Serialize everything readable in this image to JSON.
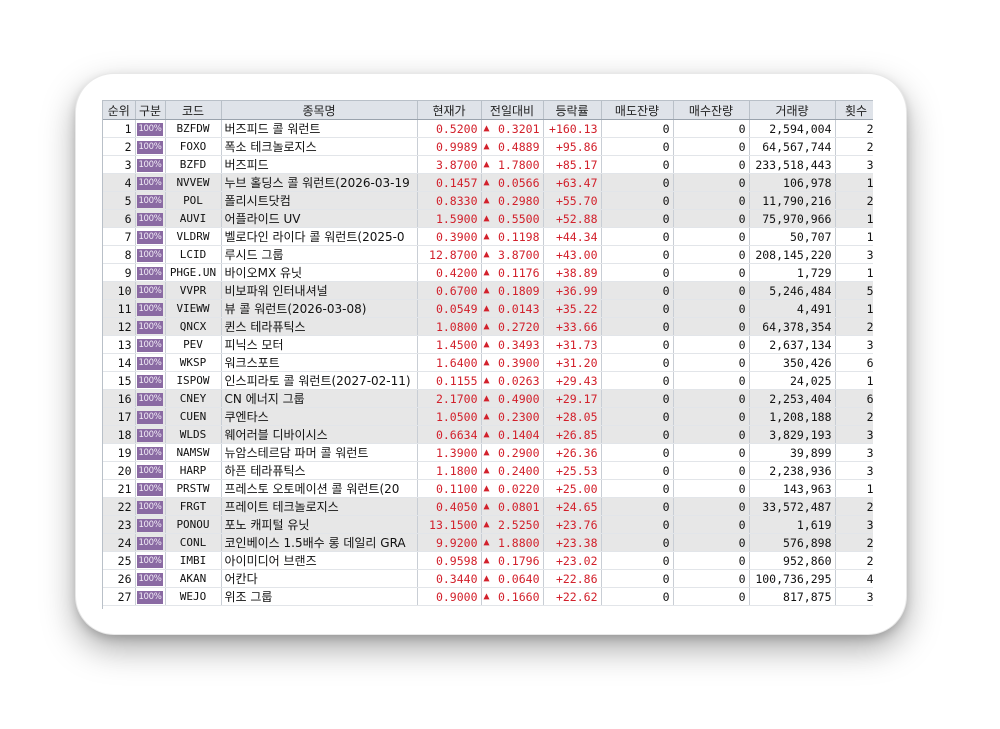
{
  "columns": [
    "순위",
    "구분",
    "코드",
    "종목명",
    "현재가",
    "전일대비",
    "등락률",
    "매도잔량",
    "매수잔량",
    "거래량",
    "횟수"
  ],
  "icons": {
    "kind_badge": "margin-100-badge",
    "change_marker": "up-triangle-icon"
  },
  "colors": {
    "up": "#d2202b",
    "badge": "#8a6aa3",
    "header_bg": "#dfe3e9",
    "shade_bg": "#e7e7e7"
  },
  "rows": [
    {
      "rank": "1",
      "kind": "100%",
      "code": "BZFDW",
      "name": "버즈피드 콜 워런트",
      "price": "0.5200",
      "diff": "0.3201",
      "rate": "+160.13",
      "ask": "0",
      "bid": "0",
      "volume": "2,594,004",
      "count": "2"
    },
    {
      "rank": "2",
      "kind": "100%",
      "code": "FOXO",
      "name": "폭소 테크놀로지스",
      "price": "0.9989",
      "diff": "0.4889",
      "rate": "+95.86",
      "ask": "0",
      "bid": "0",
      "volume": "64,567,744",
      "count": "2"
    },
    {
      "rank": "3",
      "kind": "100%",
      "code": "BZFD",
      "name": "버즈피드",
      "price": "3.8700",
      "diff": "1.7800",
      "rate": "+85.17",
      "ask": "0",
      "bid": "0",
      "volume": "233,518,443",
      "count": "3"
    },
    {
      "rank": "4",
      "kind": "100%",
      "code": "NVVEW",
      "name": "누브 홀딩스 콜 워런트(2026-03-19",
      "price": "0.1457",
      "diff": "0.0566",
      "rate": "+63.47",
      "ask": "0",
      "bid": "0",
      "volume": "106,978",
      "count": "1"
    },
    {
      "rank": "5",
      "kind": "100%",
      "code": "POL",
      "name": "폴리시트닷컴",
      "price": "0.8330",
      "diff": "0.2980",
      "rate": "+55.70",
      "ask": "0",
      "bid": "0",
      "volume": "11,790,216",
      "count": "2"
    },
    {
      "rank": "6",
      "kind": "100%",
      "code": "AUVI",
      "name": "어플라이드 UV",
      "price": "1.5900",
      "diff": "0.5500",
      "rate": "+52.88",
      "ask": "0",
      "bid": "0",
      "volume": "75,970,966",
      "count": "1"
    },
    {
      "rank": "7",
      "kind": "100%",
      "code": "VLDRW",
      "name": "벨로다인 라이다 콜 워런트(2025-0",
      "price": "0.3900",
      "diff": "0.1198",
      "rate": "+44.34",
      "ask": "0",
      "bid": "0",
      "volume": "50,707",
      "count": "1"
    },
    {
      "rank": "8",
      "kind": "100%",
      "code": "LCID",
      "name": "루시드 그룹",
      "price": "12.8700",
      "diff": "3.8700",
      "rate": "+43.00",
      "ask": "0",
      "bid": "0",
      "volume": "208,145,220",
      "count": "3"
    },
    {
      "rank": "9",
      "kind": "100%",
      "code": "PHGE.UN",
      "name": "바이오MX 유닛",
      "price": "0.4200",
      "diff": "0.1176",
      "rate": "+38.89",
      "ask": "0",
      "bid": "0",
      "volume": "1,729",
      "count": "1"
    },
    {
      "rank": "10",
      "kind": "100%",
      "code": "VVPR",
      "name": "비보파워 인터내셔널",
      "price": "0.6700",
      "diff": "0.1809",
      "rate": "+36.99",
      "ask": "0",
      "bid": "0",
      "volume": "5,246,484",
      "count": "5"
    },
    {
      "rank": "11",
      "kind": "100%",
      "code": "VIEWW",
      "name": "뷰 콜 워런트(2026-03-08)",
      "price": "0.0549",
      "diff": "0.0143",
      "rate": "+35.22",
      "ask": "0",
      "bid": "0",
      "volume": "4,491",
      "count": "1"
    },
    {
      "rank": "12",
      "kind": "100%",
      "code": "QNCX",
      "name": "퀸스 테라퓨틱스",
      "price": "1.0800",
      "diff": "0.2720",
      "rate": "+33.66",
      "ask": "0",
      "bid": "0",
      "volume": "64,378,354",
      "count": "2"
    },
    {
      "rank": "13",
      "kind": "100%",
      "code": "PEV",
      "name": "피닉스 모터",
      "price": "1.4500",
      "diff": "0.3493",
      "rate": "+31.73",
      "ask": "0",
      "bid": "0",
      "volume": "2,637,134",
      "count": "3"
    },
    {
      "rank": "14",
      "kind": "100%",
      "code": "WKSP",
      "name": "워크스포트",
      "price": "1.6400",
      "diff": "0.3900",
      "rate": "+31.20",
      "ask": "0",
      "bid": "0",
      "volume": "350,426",
      "count": "6"
    },
    {
      "rank": "15",
      "kind": "100%",
      "code": "ISPOW",
      "name": "인스피라토 콜 워런트(2027-02-11)",
      "price": "0.1155",
      "diff": "0.0263",
      "rate": "+29.43",
      "ask": "0",
      "bid": "0",
      "volume": "24,025",
      "count": "1"
    },
    {
      "rank": "16",
      "kind": "100%",
      "code": "CNEY",
      "name": "CN 에너지 그룹",
      "price": "2.1700",
      "diff": "0.4900",
      "rate": "+29.17",
      "ask": "0",
      "bid": "0",
      "volume": "2,253,404",
      "count": "6"
    },
    {
      "rank": "17",
      "kind": "100%",
      "code": "CUEN",
      "name": "쿠엔타스",
      "price": "1.0500",
      "diff": "0.2300",
      "rate": "+28.05",
      "ask": "0",
      "bid": "0",
      "volume": "1,208,188",
      "count": "2"
    },
    {
      "rank": "18",
      "kind": "100%",
      "code": "WLDS",
      "name": "웨어러블 디바이시스",
      "price": "0.6634",
      "diff": "0.1404",
      "rate": "+26.85",
      "ask": "0",
      "bid": "0",
      "volume": "3,829,193",
      "count": "3"
    },
    {
      "rank": "19",
      "kind": "100%",
      "code": "NAMSW",
      "name": "뉴암스테르담 파머 콜 워런트",
      "price": "1.3900",
      "diff": "0.2900",
      "rate": "+26.36",
      "ask": "0",
      "bid": "0",
      "volume": "39,899",
      "count": "3"
    },
    {
      "rank": "20",
      "kind": "100%",
      "code": "HARP",
      "name": "하픈 테라퓨틱스",
      "price": "1.1800",
      "diff": "0.2400",
      "rate": "+25.53",
      "ask": "0",
      "bid": "0",
      "volume": "2,238,936",
      "count": "3"
    },
    {
      "rank": "21",
      "kind": "100%",
      "code": "PRSTW",
      "name": "프레스토 오토메이션 콜 워런트(20",
      "price": "0.1100",
      "diff": "0.0220",
      "rate": "+25.00",
      "ask": "0",
      "bid": "0",
      "volume": "143,963",
      "count": "1"
    },
    {
      "rank": "22",
      "kind": "100%",
      "code": "FRGT",
      "name": "프레이트 테크놀로지스",
      "price": "0.4050",
      "diff": "0.0801",
      "rate": "+24.65",
      "ask": "0",
      "bid": "0",
      "volume": "33,572,487",
      "count": "2"
    },
    {
      "rank": "23",
      "kind": "100%",
      "code": "PONOU",
      "name": "포노 캐피털 유닛",
      "price": "13.1500",
      "diff": "2.5250",
      "rate": "+23.76",
      "ask": "0",
      "bid": "0",
      "volume": "1,619",
      "count": "3"
    },
    {
      "rank": "24",
      "kind": "100%",
      "code": "CONL",
      "name": "코인베이스 1.5배수 롱 데일리 GRA",
      "price": "9.9200",
      "diff": "1.8800",
      "rate": "+23.38",
      "ask": "0",
      "bid": "0",
      "volume": "576,898",
      "count": "2"
    },
    {
      "rank": "25",
      "kind": "100%",
      "code": "IMBI",
      "name": "아이미디어 브랜즈",
      "price": "0.9598",
      "diff": "0.1796",
      "rate": "+23.02",
      "ask": "0",
      "bid": "0",
      "volume": "952,860",
      "count": "2"
    },
    {
      "rank": "26",
      "kind": "100%",
      "code": "AKAN",
      "name": "어칸다",
      "price": "0.3440",
      "diff": "0.0640",
      "rate": "+22.86",
      "ask": "0",
      "bid": "0",
      "volume": "100,736,295",
      "count": "4"
    },
    {
      "rank": "27",
      "kind": "100%",
      "code": "WEJO",
      "name": "위조 그룹",
      "price": "0.9000",
      "diff": "0.1660",
      "rate": "+22.62",
      "ask": "0",
      "bid": "0",
      "volume": "817,875",
      "count": "3"
    }
  ]
}
